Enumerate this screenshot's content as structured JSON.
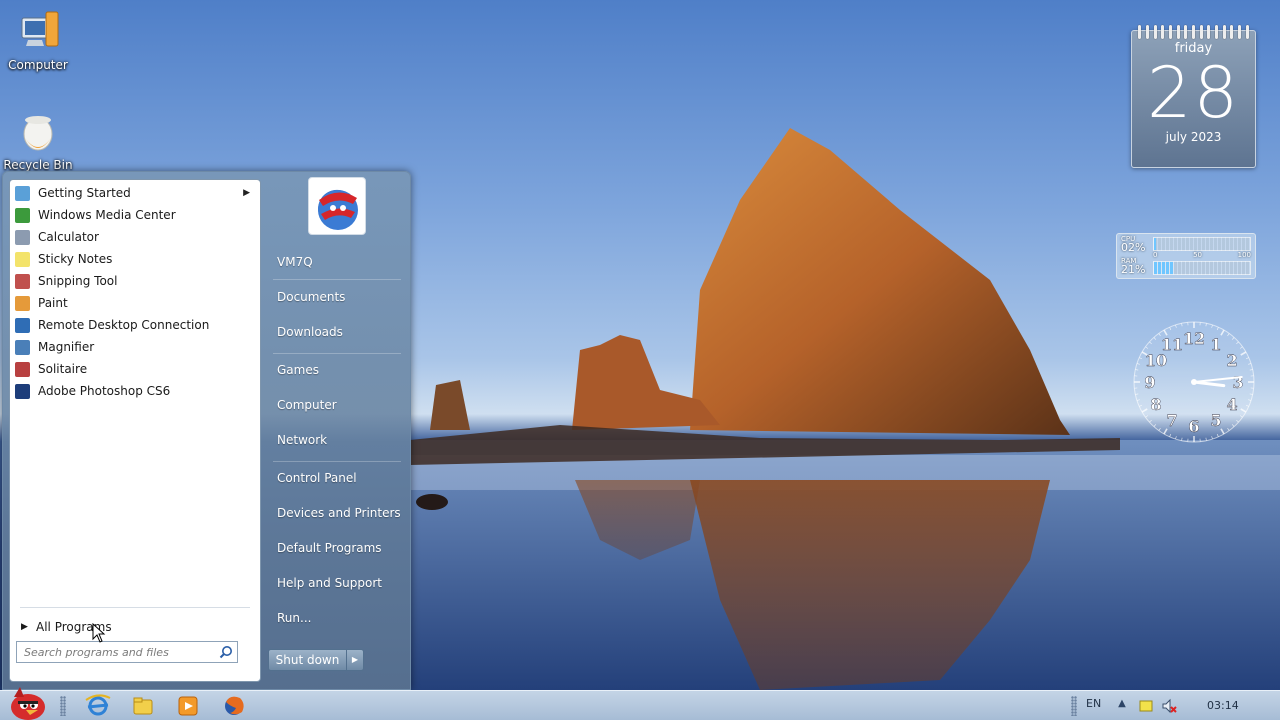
{
  "desktop": {
    "icons": [
      {
        "label": "Computer",
        "icon": "computer-icon"
      },
      {
        "label": "Recycle Bin",
        "icon": "recycle-bin-icon"
      }
    ]
  },
  "gadgets": {
    "calendar": {
      "weekday": "friday",
      "day": "28",
      "month_year": "july 2023"
    },
    "cpu_meter": {
      "cpu_label": "CPU",
      "cpu_value": "02%",
      "cpu_fraction": 0.02,
      "ram_label": "RAM",
      "ram_value": "21%",
      "ram_fraction": 0.21,
      "scale": [
        "0",
        "50",
        "100"
      ]
    },
    "clock": {
      "numbers": [
        "12",
        "1",
        "2",
        "3",
        "4",
        "5",
        "6",
        "7",
        "8",
        "9",
        "10",
        "11"
      ],
      "time": "03:14"
    }
  },
  "start_menu": {
    "programs": [
      {
        "label": "Getting Started",
        "icon": "getting-started-icon",
        "color": "#5aa0d8",
        "has_submenu": true
      },
      {
        "label": "Windows Media Center",
        "icon": "media-center-icon",
        "color": "#3c9a3c",
        "has_submenu": false
      },
      {
        "label": "Calculator",
        "icon": "calculator-icon",
        "color": "#8c9bb0",
        "has_submenu": false
      },
      {
        "label": "Sticky Notes",
        "icon": "sticky-notes-icon",
        "color": "#f3e36b",
        "has_submenu": false
      },
      {
        "label": "Snipping Tool",
        "icon": "snipping-tool-icon",
        "color": "#c0504d",
        "has_submenu": false
      },
      {
        "label": "Paint",
        "icon": "paint-icon",
        "color": "#e59a3a",
        "has_submenu": false
      },
      {
        "label": "Remote Desktop Connection",
        "icon": "remote-desktop-icon",
        "color": "#2f6db5",
        "has_submenu": false
      },
      {
        "label": "Magnifier",
        "icon": "magnifier-icon",
        "color": "#4a7fb8",
        "has_submenu": false
      },
      {
        "label": "Solitaire",
        "icon": "solitaire-icon",
        "color": "#b84040",
        "has_submenu": false
      },
      {
        "label": "Adobe Photoshop CS6",
        "icon": "photoshop-icon",
        "color": "#1d3d7a",
        "has_submenu": false
      }
    ],
    "all_programs": "All Programs",
    "search_placeholder": "Search programs and files",
    "right_items": [
      {
        "label": "VM7Q",
        "name": "user-name-link"
      },
      {
        "label": "Documents",
        "name": "documents-link"
      },
      {
        "label": "Downloads",
        "name": "downloads-link"
      },
      {
        "label": "Games",
        "name": "games-link"
      },
      {
        "label": "Computer",
        "name": "computer-link"
      },
      {
        "label": "Network",
        "name": "network-link"
      },
      {
        "label": "Control Panel",
        "name": "control-panel-link"
      },
      {
        "label": "Devices and Printers",
        "name": "devices-printers-link"
      },
      {
        "label": "Default Programs",
        "name": "default-programs-link"
      },
      {
        "label": "Help and Support",
        "name": "help-support-link"
      },
      {
        "label": "Run...",
        "name": "run-link"
      }
    ],
    "shutdown_label": "Shut down"
  },
  "taskbar": {
    "pinned": [
      "internet-explorer-icon",
      "file-explorer-icon",
      "media-player-icon",
      "firefox-icon"
    ],
    "language": "EN",
    "time": "03:14"
  }
}
